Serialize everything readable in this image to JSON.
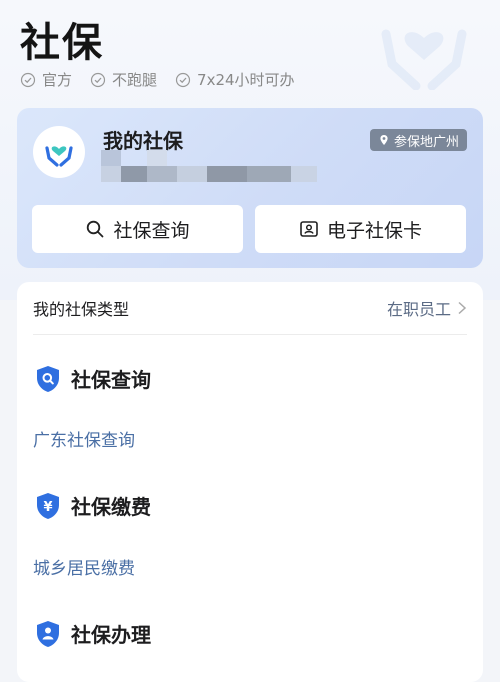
{
  "header": {
    "title": "社保",
    "tags": [
      "官方",
      "不跑腿",
      "7x24小时可办"
    ]
  },
  "card": {
    "title": "我的社保",
    "location": "参保地广州",
    "buttons": {
      "query": "社保查询",
      "card": "电子社保卡"
    }
  },
  "type_row": {
    "label": "我的社保类型",
    "value": "在职员工"
  },
  "sections": [
    {
      "title": "社保查询",
      "link": "广东社保查询"
    },
    {
      "title": "社保缴费",
      "link": "城乡居民缴费"
    },
    {
      "title": "社保办理"
    }
  ],
  "colors": {
    "accent": "#2f6fe0",
    "link": "#4a6fa5",
    "badge_bg": "#7b8799"
  }
}
